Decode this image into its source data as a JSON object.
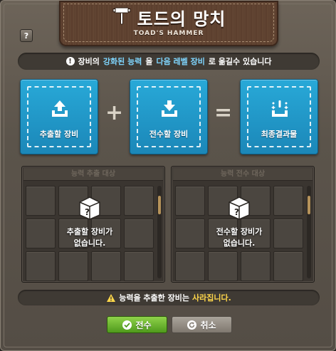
{
  "window": {
    "title": "토드의 망치",
    "subtitle": "TOAD'S HAMMER",
    "help_label": "?"
  },
  "info": {
    "prefix": "장비의",
    "highlight1": "강화된 능력",
    "middle": "을",
    "highlight2": "다음 레벨 장비",
    "suffix": "로 옮길수 있습니다"
  },
  "boxes": {
    "extract_label": "추출할 장비",
    "transfer_label": "전수할 장비",
    "final_label": "최종결과물",
    "plus": "+",
    "equals": "="
  },
  "panels": {
    "left_header": "능력 추출 대상",
    "left_msg_line1": "추출할 장비가",
    "left_msg_line2": "없습니다.",
    "right_header": "능력 전수 대상",
    "right_msg_line1": "전수할 장비가",
    "right_msg_line2": "없습니다."
  },
  "warning": {
    "prefix": "능력을 추출한 장비는",
    "highlight": "사라집니다."
  },
  "buttons": {
    "transfer_label": "전수",
    "cancel_label": "취소"
  },
  "colors": {
    "accent_blue": "#1f97c9",
    "title_plate": "#5e4230",
    "highlight_yellow": "#ffd74a",
    "confirm_green": "#6cb52c"
  },
  "icons": {
    "title": "hammer-icon",
    "extract": "upload-icon",
    "transfer": "download-icon",
    "final": "sparkle-box-icon",
    "empty": "question-box-icon",
    "warning": "warning-icon",
    "info": "exclamation-icon",
    "confirm": "check-icon",
    "cancel": "refresh-icon"
  }
}
